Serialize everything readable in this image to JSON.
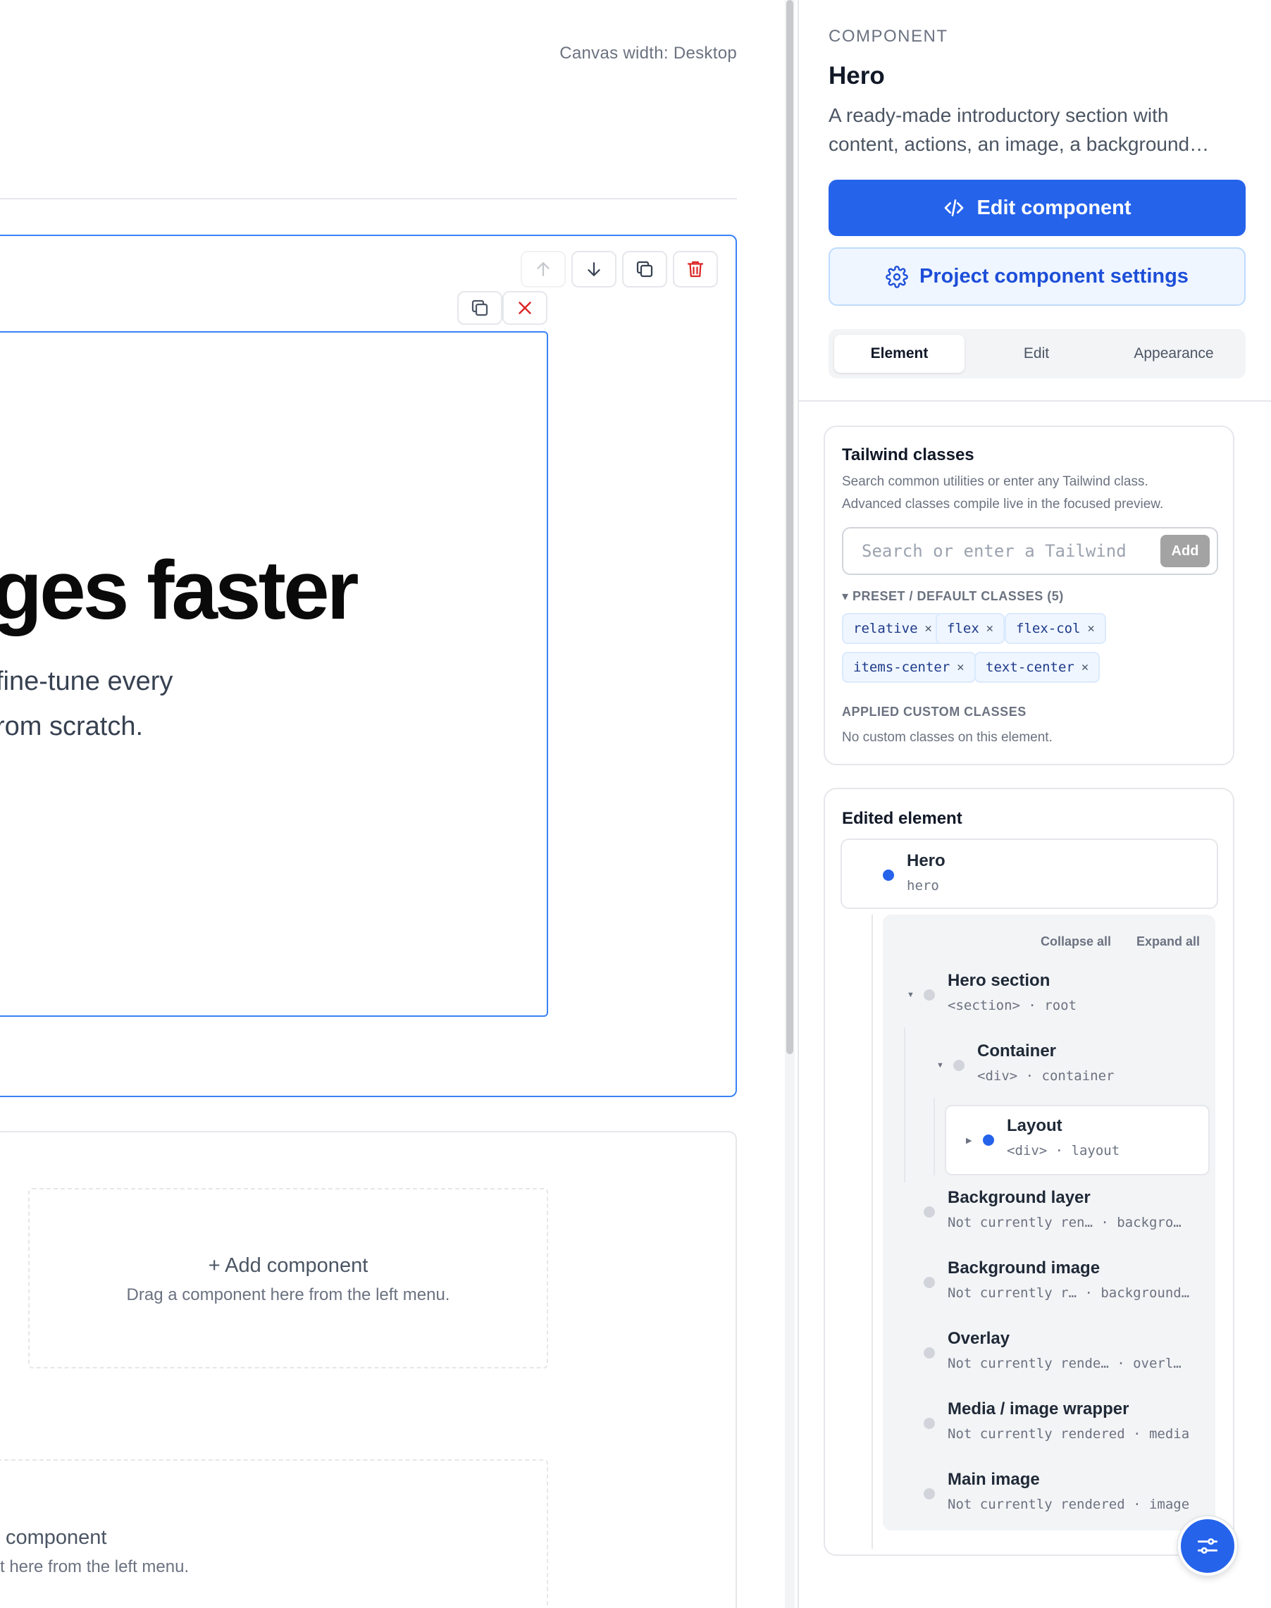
{
  "canvas": {
    "width_label": "Canvas width: Desktop",
    "hero_heading": "ges faster",
    "hero_sub_line1": "fine-tune every",
    "hero_sub_line2": "rom scratch.",
    "add_component_label": "+ Add component",
    "add_component_hint": "Drag a component here from the left menu.",
    "add_component_label_2": "component",
    "add_component_hint_2": "t here from the left menu."
  },
  "panel": {
    "kicker": "COMPONENT",
    "title": "Hero",
    "description": "A ready-made introductory section with content, actions, an image, a background…",
    "edit_button": "Edit component",
    "settings_button": "Project component settings",
    "tabs": [
      {
        "label": "Element",
        "active": true
      },
      {
        "label": "Edit",
        "active": false
      },
      {
        "label": "Appearance",
        "active": false
      }
    ]
  },
  "tailwind": {
    "title": "Tailwind classes",
    "help_line1": "Search common utilities or enter any Tailwind class.",
    "help_line2": "Advanced classes compile live in the focused preview.",
    "search_placeholder": "Search or enter a Tailwind",
    "add_button": "Add",
    "preset_header": "▾ PRESET / DEFAULT CLASSES (5)",
    "preset_classes": [
      "relative",
      "flex",
      "flex-col",
      "items-center",
      "text-center"
    ],
    "applied_header": "APPLIED CUSTOM CLASSES",
    "applied_empty": "No custom classes on this element."
  },
  "edited_element": {
    "title": "Edited element",
    "root": {
      "name": "Hero",
      "meta": "hero"
    },
    "collapse_all": "Collapse all",
    "expand_all": "Expand all",
    "nodes": [
      {
        "name": "Hero section",
        "meta": "<section> · root"
      },
      {
        "name": "Container",
        "meta": "<div> · container"
      },
      {
        "name": "Layout",
        "meta": "<div> · layout"
      },
      {
        "name": "Background layer",
        "meta": "Not currently ren…  · backgro…"
      },
      {
        "name": "Background image",
        "meta": "Not currently r… · background…"
      },
      {
        "name": "Overlay",
        "meta": "Not currently rende…  · overl…"
      },
      {
        "name": "Media / image wrapper",
        "meta": "Not currently rendered · media"
      },
      {
        "name": "Main image",
        "meta": "Not currently rendered · image"
      }
    ]
  },
  "colors": {
    "accent": "#2563eb",
    "selection": "#3b82f6",
    "danger": "#dc2626"
  },
  "icons": {
    "move_up": "arrow-up-icon",
    "move_down": "arrow-down-icon",
    "duplicate": "copy-icon",
    "delete": "trash-icon",
    "close": "close-icon",
    "edit": "code-icon",
    "settings": "gear-icon",
    "fab": "sliders-icon"
  }
}
